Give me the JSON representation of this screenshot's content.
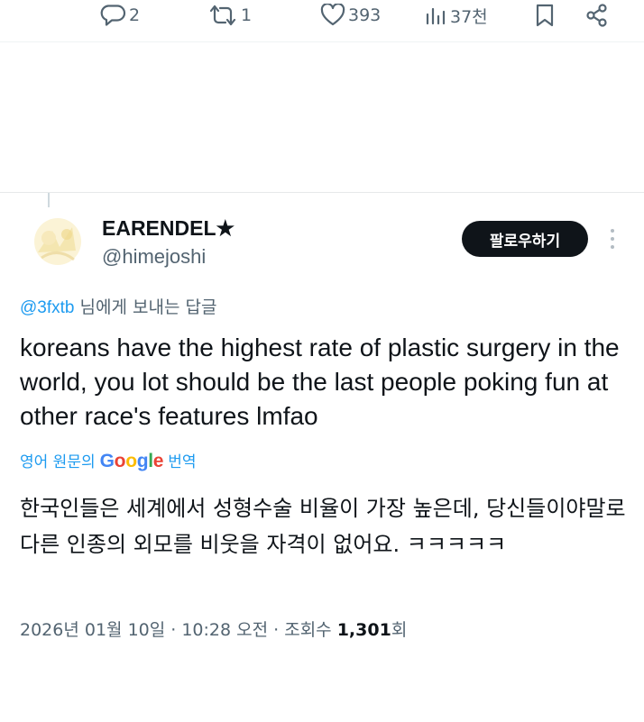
{
  "actions": {
    "replies": "2",
    "retweets": "1",
    "likes": "393",
    "views": "37천"
  },
  "tweet": {
    "author_name": "EARENDEL★",
    "author_handle": "@himejoshi",
    "follow_label": "팔로우하기",
    "reply_to_handle": "@3fxtb",
    "reply_to_suffix": " 님에게 보내는 답글",
    "text": "koreans have the highest rate of plastic surgery in the world, you lot should be the last people poking fun at other race's features lmfao",
    "translate_prefix": "영어 원문의",
    "translate_brand": "Google",
    "translate_suffix": "번역",
    "translated_text": "한국인들은 세계에서 성형수술 비율이 가장 높은데, 당신들이야말로 다른 인종의 외모를 비웃을 자격이 없어요. ㅋㅋㅋㅋㅋ",
    "timestamp": "2026년 01월 10일 · 10:28 오전 · 조회수 ",
    "view_count": "1,301",
    "view_suffix": "회"
  },
  "colors": {
    "text_primary": "#0f1419",
    "text_secondary": "#536471",
    "link": "#1d9bf0",
    "follow_bg": "#0f1419"
  },
  "icons": [
    "reply-icon",
    "retweet-icon",
    "like-icon",
    "views-icon",
    "bookmark-icon",
    "share-icon",
    "more-icon"
  ]
}
